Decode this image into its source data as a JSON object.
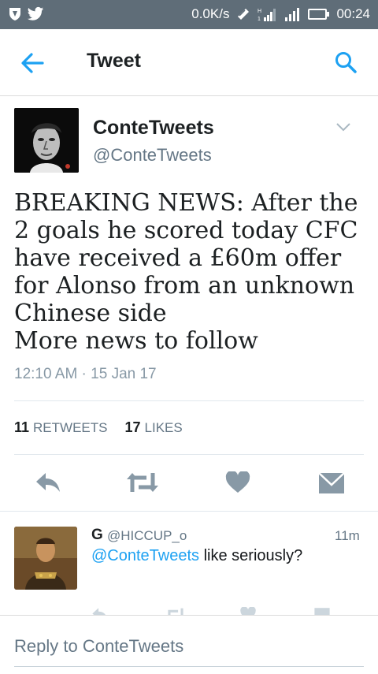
{
  "status_bar": {
    "speed": "0.0K/s",
    "time": "00:24",
    "sim_labels": "H 1"
  },
  "app_bar": {
    "title": "Tweet",
    "back_icon": "arrow-left-icon",
    "search_icon": "search-icon",
    "accent": "#1da1f2"
  },
  "tweet": {
    "name": "ConteTweets",
    "handle": "@ConteTweets",
    "text": "BREAKING NEWS: After the\n2 goals he scored today CFC\nhave received a £60m offer\nfor Alonso from an unknown\nChinese side\nMore news to follow",
    "timestamp": "12:10 AM · 15 Jan 17",
    "retweets_count": "11",
    "retweets_label": "RETWEETS",
    "likes_count": "17",
    "likes_label": "LIKES"
  },
  "reply": {
    "name": "G",
    "handle": "@HICCUP_o",
    "time": "11m",
    "mention": "@ConteTweets",
    "text": " like seriously?"
  },
  "composer": {
    "placeholder": "Reply to ConteTweets"
  }
}
